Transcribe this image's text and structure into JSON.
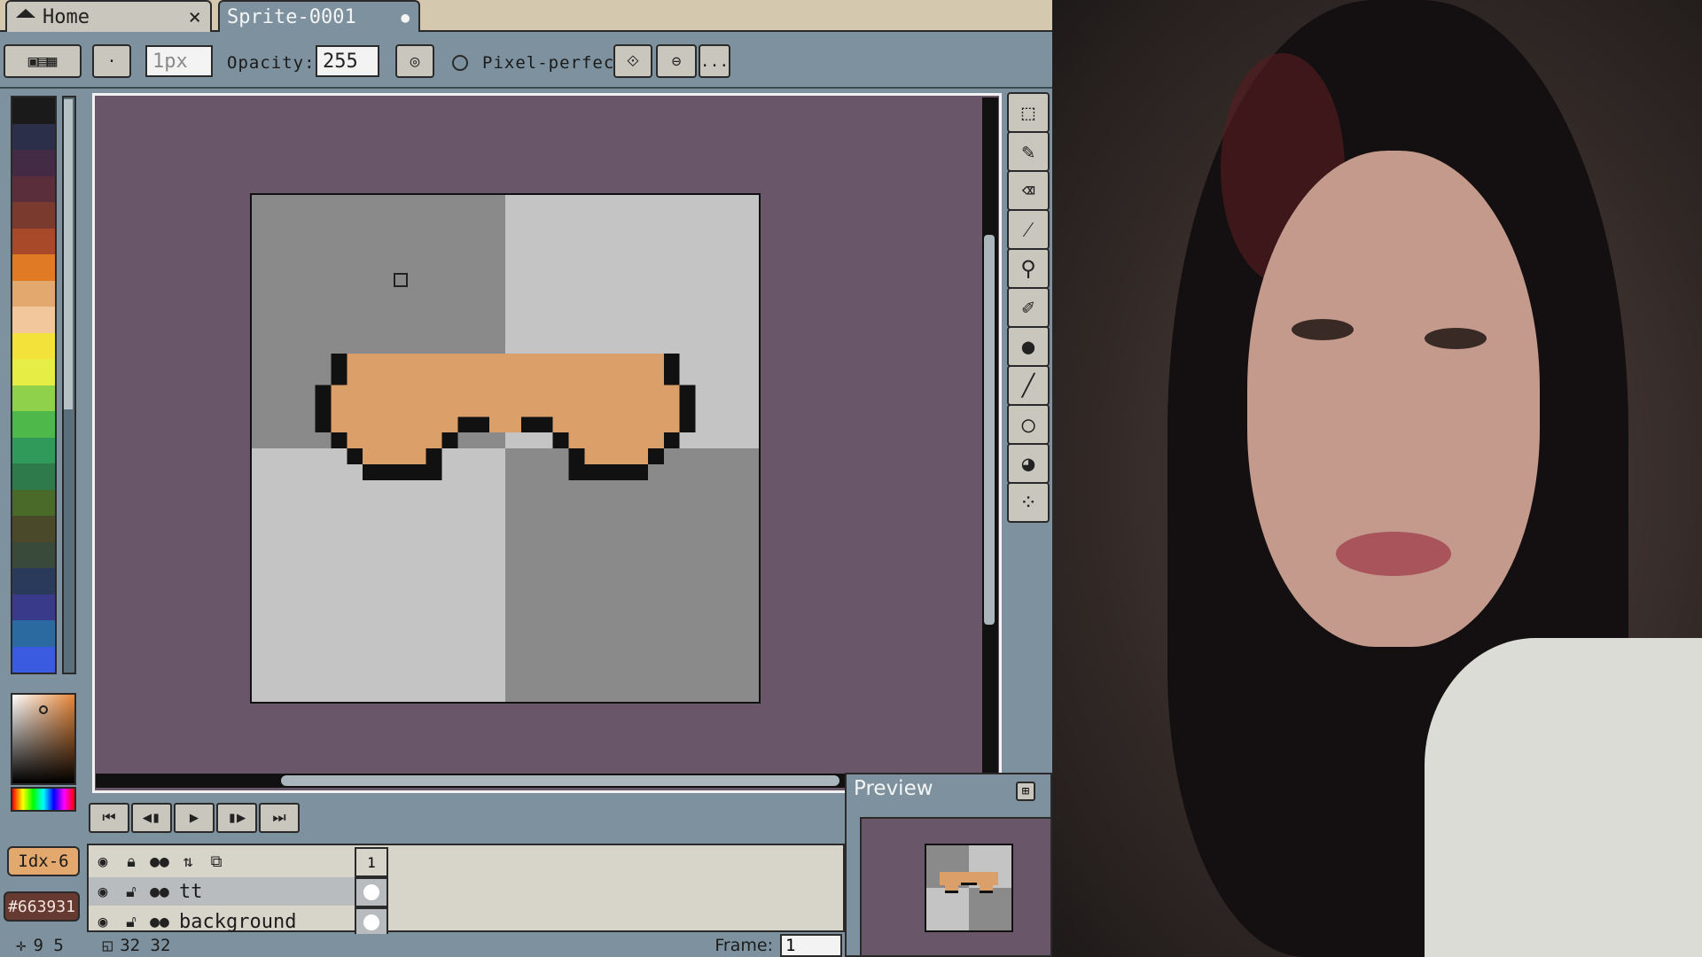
{
  "tabs": [
    {
      "label": "Home",
      "icon": "home-icon",
      "close": "×"
    },
    {
      "label": "Sprite-0001",
      "modified_dot": "●"
    }
  ],
  "toolbar": {
    "brush_size": "1px",
    "opacity_label": "Opacity:",
    "opacity_value": "255",
    "pixel_perfect_label": "Pixel-perfect",
    "more_label": "..."
  },
  "palette": {
    "colors": [
      "#1a1a1a",
      "#2b2f4a",
      "#432b45",
      "#5a2e3b",
      "#7a3a2e",
      "#a84a2a",
      "#e07a24",
      "#e3a86d",
      "#f1c79b",
      "#f2e23a",
      "#e6ee45",
      "#8fd14a",
      "#4fb84a",
      "#2f9a5a",
      "#2f7a4a",
      "#4a6a2a",
      "#4a4a2a",
      "#3a4a3a",
      "#2a3a5a",
      "#3a3a8a",
      "#2a6aa0",
      "#3a5ae0"
    ]
  },
  "color_index": "Idx-6",
  "color_hex": "#663931",
  "sprite": {
    "checker_dark": "#8a8a8a",
    "checker_light": "#c4c4c4",
    "glasses_fill": "#dba06a",
    "outline": "#111111"
  },
  "tools": [
    "marquee-icon",
    "pencil-icon",
    "eraser-icon",
    "eyedropper-icon",
    "zoom-icon",
    "brush-icon",
    "fill-icon",
    "line-icon",
    "ellipse-icon",
    "blur-icon",
    "spray-icon"
  ],
  "animation": {
    "buttons": [
      "⏮",
      "◀▮",
      "▶",
      "▮▶",
      "⏭"
    ]
  },
  "timeline": {
    "frame_number": "1",
    "layers": [
      {
        "name": "tt"
      },
      {
        "name": "background"
      }
    ]
  },
  "status": {
    "cursor_pos": "9 5",
    "sprite_size": "32 32",
    "frame_label": "Frame:",
    "frame_value": "1"
  },
  "preview": {
    "title": "Preview"
  }
}
